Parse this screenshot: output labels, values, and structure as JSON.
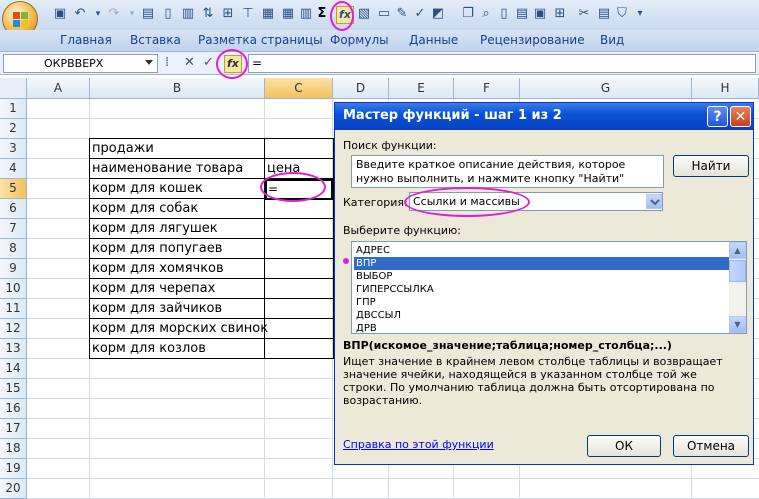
{
  "toolbar": {
    "sigma_label": "Σ",
    "fx_label": "fx",
    "customize_label": "▾"
  },
  "ribbon_tabs": [
    "Главная",
    "Вставка",
    "Разметка страницы",
    "Формулы",
    "Данные",
    "Рецензирование",
    "Вид"
  ],
  "formula_bar": {
    "name_box": "ОКРВВЕРХ",
    "cancel_symbol": "✕",
    "enter_symbol": "✓",
    "fx_symbol": "fx",
    "formula": "="
  },
  "grid": {
    "columns": [
      "A",
      "B",
      "C",
      "D",
      "E",
      "F",
      "G",
      "H"
    ],
    "rows": [
      "1",
      "2",
      "3",
      "4",
      "5",
      "6",
      "7",
      "8",
      "9",
      "10",
      "11",
      "12",
      "13",
      "14",
      "15",
      "16",
      "17",
      "18",
      "19",
      "20"
    ],
    "cells": {
      "B3": "продажи",
      "B4": "наименование товара",
      "C4": "цена",
      "B5": "корм для кошек",
      "B6": "корм для собак",
      "B7": "корм для лягушек",
      "B8": "корм для попугаев",
      "B9": "корм для хомячков",
      "B10": "корм для черепах",
      "B11": "корм для зайчиков",
      "B12": "корм для морских свинок",
      "B13": "корм для козлов",
      "C5": "="
    }
  },
  "dialog": {
    "title": "Мастер функций - шаг 1 из 2",
    "help_symbol": "?",
    "close_symbol": "✕",
    "search_label": "Поиск функции:",
    "search_text": "Введите краткое описание действия, которое нужно выполнить, и нажмите кнопку \"Найти\"",
    "find_button": "Найти",
    "category_label": "Категория:",
    "category_value": "Ссылки и массивы",
    "select_label": "Выберите функцию:",
    "functions": [
      "АДРЕС",
      "ВПР",
      "ВЫБОР",
      "ГИПЕРССЫЛКА",
      "ГПР",
      "ДВССЫЛ",
      "ДРВ"
    ],
    "selected_function": "ВПР",
    "syntax": "ВПР(искомое_значение;таблица;номер_столбца;...)",
    "description": "Ищет значение в крайнем левом столбце таблицы и возвращает значение ячейки, находящейся в указанном столбце той же строки. По умолчанию таблица должна быть отсортирована по возрастанию.",
    "help_link": "Справка по этой функции",
    "ok_button": "ОК",
    "cancel_button": "Отмена"
  },
  "colors": {
    "annotation": "#e020d0",
    "selection": "#316ac5",
    "dialog_title": "#0a52d8"
  }
}
